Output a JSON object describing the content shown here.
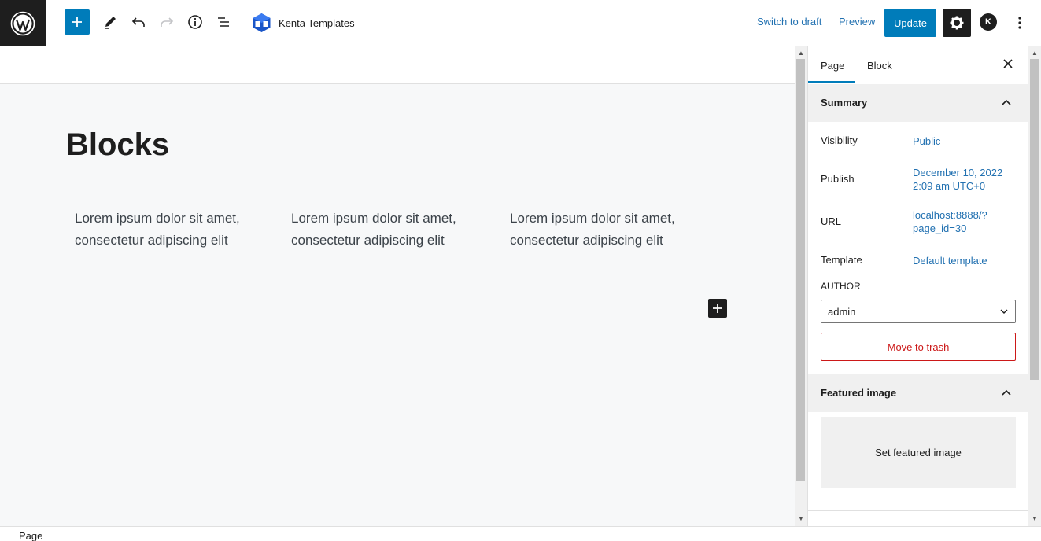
{
  "topbar": {
    "brand_name": "Kenta Templates",
    "switch_to_draft": "Switch to draft",
    "preview": "Preview",
    "update": "Update",
    "avatar_letter": "K",
    "icons": [
      "wordpress-logo-icon",
      "plus-icon",
      "pencil-icon",
      "undo-icon",
      "redo-icon",
      "info-icon",
      "list-view-icon",
      "kenta-logo-icon",
      "gear-icon",
      "more-vertical-icon"
    ]
  },
  "canvas": {
    "title": "Blocks",
    "columns": [
      {
        "line1": "Lorem ipsum dolor sit amet,",
        "line2": "consectetur adipiscing elit"
      },
      {
        "line1": "Lorem ipsum dolor sit amet,",
        "line2": "consectetur adipiscing elit"
      },
      {
        "line1": "Lorem ipsum dolor sit amet,",
        "line2": "consectetur adipiscing elit"
      }
    ]
  },
  "sidebar": {
    "tabs": [
      {
        "label": "Page",
        "active": true
      },
      {
        "label": "Block",
        "active": false
      }
    ],
    "summary": {
      "heading": "Summary",
      "visibility_label": "Visibility",
      "visibility_value": "Public",
      "publish_label": "Publish",
      "publish_value_line1": "December 10, 2022",
      "publish_value_line2": "2:09 am UTC+0",
      "url_label": "URL",
      "url_value_line1": "localhost:8888/?",
      "url_value_line2": "page_id=30",
      "template_label": "Template",
      "template_value": "Default template",
      "author_label": "AUTHOR",
      "author_value": "admin",
      "trash_label": "Move to trash"
    },
    "featured": {
      "heading": "Featured image",
      "set_label": "Set featured image"
    }
  },
  "footer": {
    "breadcrumb": "Page"
  },
  "colors": {
    "accent": "#007cba",
    "link": "#2271b1",
    "danger": "#cc1818",
    "dark": "#1e1e1e"
  }
}
